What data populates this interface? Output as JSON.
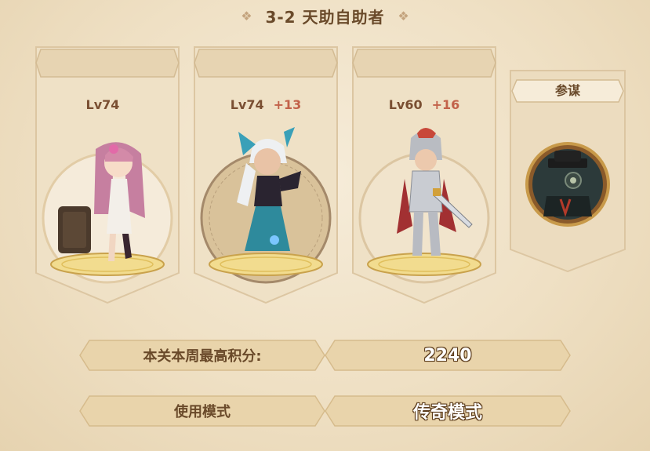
{
  "stage_title": "3-2 天助自助者",
  "heroes": [
    {
      "level": "Lv74",
      "plus": ""
    },
    {
      "level": "Lv74",
      "plus": "+13"
    },
    {
      "level": "Lv60",
      "plus": "+16"
    }
  ],
  "strategist": {
    "label": "参谋"
  },
  "score": {
    "label": "本关本周最高积分:",
    "value": "2240"
  },
  "mode": {
    "label": "使用模式",
    "value": "传奇模式"
  }
}
